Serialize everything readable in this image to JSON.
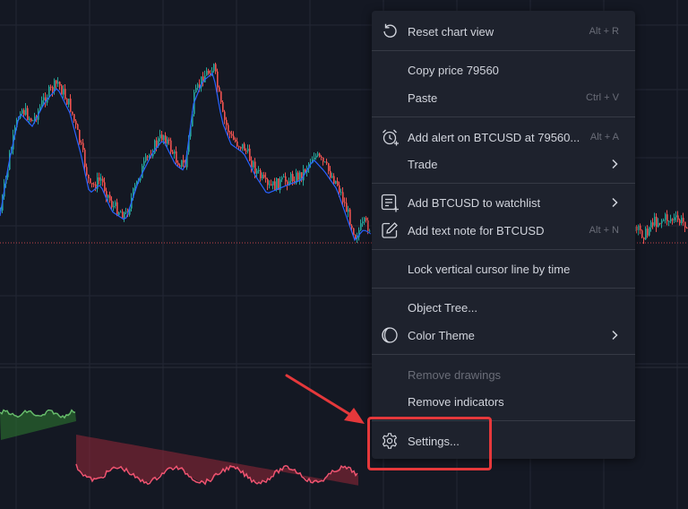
{
  "chart": {
    "colors": {
      "background": "#141823",
      "grid": "#232735",
      "up_candle": "#26a69a",
      "down_candle": "#ef5350",
      "moving_average": "#2962ff",
      "price_line": "#c2424a",
      "oscillator_positive": "#2e7d32",
      "oscillator_positive_line": "#66bb6a",
      "oscillator_negative": "#8b2635",
      "oscillator_negative_line": "#ef5370"
    }
  },
  "context_menu": {
    "items": [
      {
        "id": "reset-chart-view",
        "label": "Reset chart view",
        "shortcut": "Alt + R",
        "icon": "reset-icon"
      },
      {
        "id": "copy-price",
        "label": "Copy price 79560",
        "shortcut": ""
      },
      {
        "id": "paste",
        "label": "Paste",
        "shortcut": "Ctrl + V"
      },
      {
        "id": "add-alert",
        "label": "Add alert on BTCUSD at 79560...",
        "shortcut": "Alt + A",
        "icon": "alarm-clock-icon"
      },
      {
        "id": "trade",
        "label": "Trade",
        "submenu": true
      },
      {
        "id": "add-to-watchlist",
        "label": "Add BTCUSD to watchlist",
        "submenu": true,
        "icon": "watchlist-add-icon"
      },
      {
        "id": "add-text-note",
        "label": "Add text note for BTCUSD",
        "shortcut": "Alt + N",
        "icon": "edit-note-icon"
      },
      {
        "id": "lock-vertical-cursor",
        "label": "Lock vertical cursor line by time"
      },
      {
        "id": "object-tree",
        "label": "Object Tree..."
      },
      {
        "id": "color-theme",
        "label": "Color Theme",
        "submenu": true,
        "icon": "moon-icon"
      },
      {
        "id": "remove-drawings",
        "label": "Remove drawings",
        "disabled": true
      },
      {
        "id": "remove-indicators",
        "label": "Remove indicators"
      },
      {
        "id": "settings",
        "label": "Settings...",
        "icon": "gear-icon"
      }
    ]
  },
  "annotation": {
    "highlight_color": "#e5383b"
  }
}
